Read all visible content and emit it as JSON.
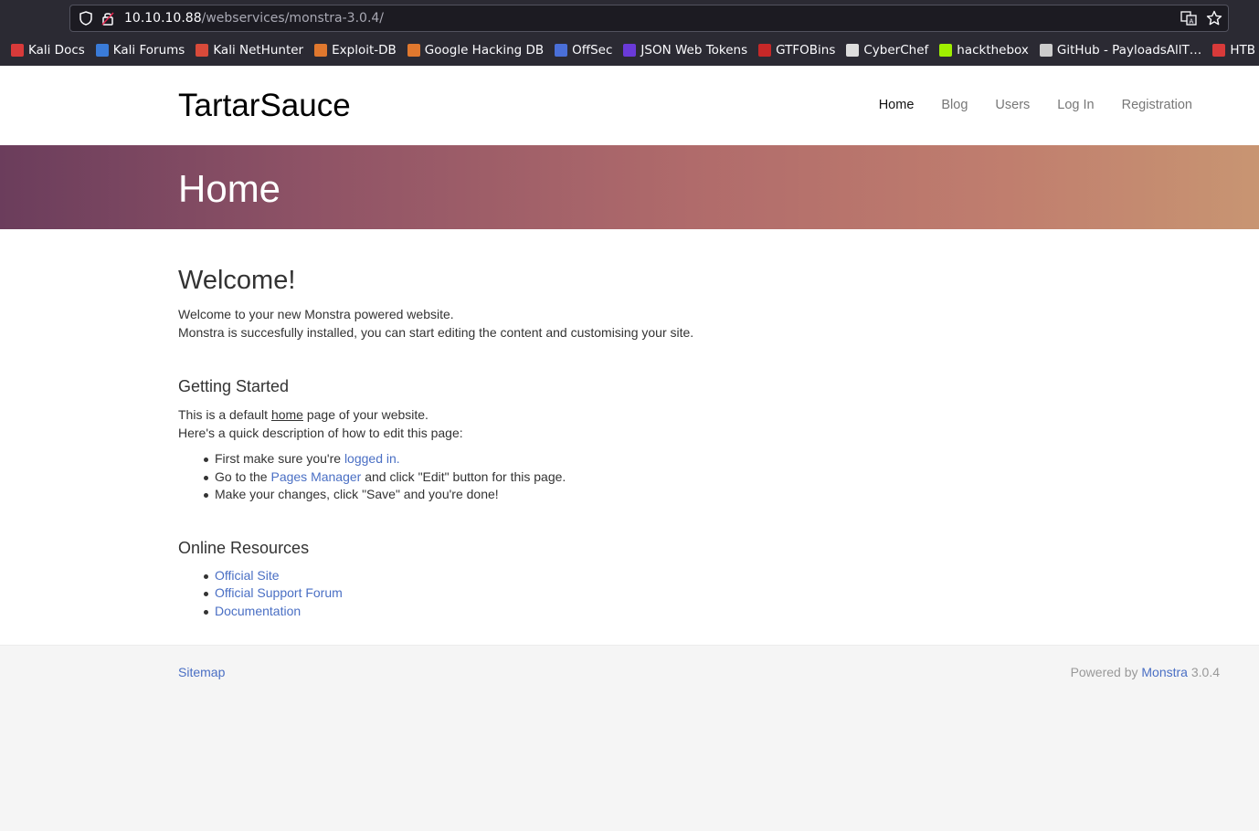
{
  "browser": {
    "url_host": "10.10.10.88",
    "url_path": "/webservices/monstra-3.0.4/",
    "bookmarks": [
      {
        "label": "Kali Docs",
        "color": "#d83a3a"
      },
      {
        "label": "Kali Forums",
        "color": "#3a7bd8"
      },
      {
        "label": "Kali NetHunter",
        "color": "#d84a3a"
      },
      {
        "label": "Exploit-DB",
        "color": "#e0782e"
      },
      {
        "label": "Google Hacking DB",
        "color": "#e0782e"
      },
      {
        "label": "OffSec",
        "color": "#4a6fd8"
      },
      {
        "label": "JSON Web Tokens",
        "color": "#6a3ad8"
      },
      {
        "label": "GTFOBins",
        "color": "#c62828"
      },
      {
        "label": "CyberChef",
        "color": "#dddddd"
      },
      {
        "label": "hackthebox",
        "color": "#9fef00"
      },
      {
        "label": "GitHub - PayloadsAllT…",
        "color": "#cccccc"
      },
      {
        "label": "HTB",
        "color": "#d83a3a"
      }
    ]
  },
  "site": {
    "brand": "TartarSauce",
    "nav": [
      "Home",
      "Blog",
      "Users",
      "Log In",
      "Registration"
    ],
    "hero_title": "Home"
  },
  "content": {
    "welcome_title": "Welcome!",
    "welcome_line1": "Welcome to your new Monstra powered website.",
    "welcome_line2": "Monstra is succesfully installed, you can start editing the content and customising your site.",
    "getting_started_title": "Getting Started",
    "gs_line1_pre": "This is a default ",
    "gs_line1_link": "home",
    "gs_line1_post": " page of your website.",
    "gs_line2": "Here's a quick description of how to edit this page:",
    "step1_pre": "First make sure you're ",
    "step1_link": "logged in.",
    "step2_pre": "Go to the ",
    "step2_link": "Pages Manager",
    "step2_post": " and click \"Edit\" button for this page.",
    "step3": "Make your changes, click \"Save\" and you're done!",
    "resources_title": "Online Resources",
    "resources": [
      "Official Site",
      "Official Support Forum",
      "Documentation"
    ]
  },
  "footer": {
    "sitemap": "Sitemap",
    "powered_pre": "Powered by ",
    "powered_link": "Monstra",
    "powered_version": " 3.0.4"
  }
}
